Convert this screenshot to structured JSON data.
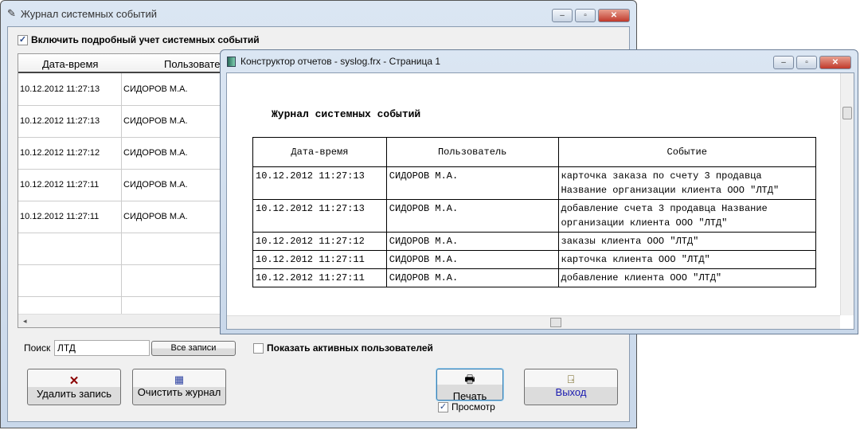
{
  "main_window": {
    "title": "Журнал системных событий",
    "enable_checkbox_label": "Включить подробный учет системных событий",
    "enable_checked": true,
    "grid": {
      "columns": [
        "Дата-время",
        "Пользовате"
      ],
      "rows": [
        [
          "10.12.2012 11:27:13",
          "СИДОРОВ М.А."
        ],
        [
          "10.12.2012 11:27:13",
          "СИДОРОВ М.А."
        ],
        [
          "10.12.2012 11:27:12",
          "СИДОРОВ М.А."
        ],
        [
          "10.12.2012 11:27:11",
          "СИДОРОВ М.А."
        ],
        [
          "10.12.2012 11:27:11",
          "СИДОРОВ М.А."
        ]
      ]
    },
    "search_label": "Поиск",
    "search_value": "ЛТД",
    "all_records": "Все записи",
    "active_users_label": "Показать активных пользователей",
    "delete_button": "Удалить запись",
    "clear_button": "Очистить журнал",
    "print_button": "Печать",
    "preview_label": "Просмотр",
    "preview_checked": true,
    "exit_button": "Выход"
  },
  "report_window": {
    "title": "Конструктор отчетов - syslog.frx - Страница 1",
    "report_title": "Журнал системных событий",
    "columns": [
      "Дата-время",
      "Пользователь",
      "Событие"
    ],
    "rows": [
      [
        "10.12.2012 11:27:13",
        "СИДОРОВ М.А.",
        "карточка заказа по счету 3 продавца Название организации клиента ООО \"ЛТД\""
      ],
      [
        "10.12.2012 11:27:13",
        "СИДОРОВ М.А.",
        "добавление счета 3 продавца Название организации клиента ООО \"ЛТД\""
      ],
      [
        "10.12.2012 11:27:12",
        "СИДОРОВ М.А.",
        "заказы клиента ООО \"ЛТД\""
      ],
      [
        "10.12.2012 11:27:11",
        "СИДОРОВ М.А.",
        "карточка клиента ООО \"ЛТД\""
      ],
      [
        "10.12.2012 11:27:11",
        "СИДОРОВ М.А.",
        "добавление клиента ООО \"ЛТД\""
      ]
    ]
  }
}
